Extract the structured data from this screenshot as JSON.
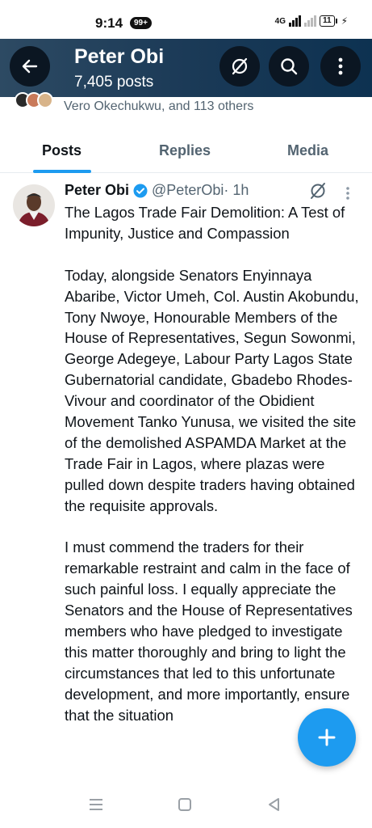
{
  "status_bar": {
    "time": "9:14",
    "notification_badge": "99+",
    "network": "4G",
    "battery": "11"
  },
  "header": {
    "title": "Peter Obi",
    "post_count": "7,405 posts",
    "icons": [
      "back-arrow-icon",
      "grok-icon",
      "search-icon",
      "more-vertical-icon"
    ]
  },
  "social_context": {
    "text": "Vero Okechukwu, and 113 others"
  },
  "tabs": [
    {
      "label": "Posts",
      "active": true
    },
    {
      "label": "Replies",
      "active": false
    },
    {
      "label": "Media",
      "active": false
    }
  ],
  "tweet": {
    "author_name": "Peter Obi",
    "handle": "@PeterObi",
    "time": " · 1h",
    "verified": true,
    "paragraphs": [
      "The Lagos Trade Fair Demolition: A Test of Impunity, Justice and Compassion",
      "Today, alongside Senators Enyinnaya Abaribe, Victor Umeh, Col. Austin Akobundu, Tony Nwoye, Honourable Members of the House of Representatives, Segun Sowonmi, George Adegeye, Labour Party Lagos State Gubernatorial candidate, Gbadebo Rhodes-Vivour and coordinator of the Obidient Movement Tanko Yunusa, we visited the site of the demolished ASPAMDA  Market at the Trade Fair in Lagos, where plazas were pulled down despite traders having obtained the requisite approvals.",
      "I must commend the traders for their remarkable restraint and calm in the face of such painful loss. I equally appreciate the Senators and the House of Representatives members who have pledged to investigate this matter thoroughly and bring to light the circumstances that led to this unfortunate development, and more importantly, ensure that the situation"
    ]
  },
  "fab": {
    "icon": "plus-icon"
  },
  "nav_bar": {
    "icons": [
      "recents-icon",
      "home-icon",
      "back-icon"
    ]
  },
  "colors": {
    "accent": "#1d9bf0",
    "header_bg": "#1b3a57",
    "muted_text": "#536471"
  }
}
